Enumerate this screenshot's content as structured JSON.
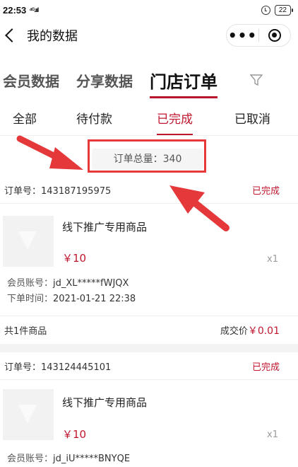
{
  "status_bar": {
    "time": "22:53",
    "signal": "⁴ᴳ.ııl",
    "battery": "22"
  },
  "navbar": {
    "title": "我的数据",
    "more_label": "•••"
  },
  "main_tabs": [
    {
      "label": "会员数据"
    },
    {
      "label": "分享数据"
    },
    {
      "label": "门店订单",
      "active": true
    }
  ],
  "sub_tabs": [
    {
      "label": "全部"
    },
    {
      "label": "待付款"
    },
    {
      "label": "已完成",
      "active": true
    },
    {
      "label": "已取消"
    }
  ],
  "total": {
    "label": "订单总量：",
    "value": "340"
  },
  "orders": [
    {
      "order_label": "订单号：",
      "order_no": "143187195975",
      "status": "已完成",
      "product_name": "线下推广专用商品",
      "price": "￥10",
      "qty": "x1",
      "member_label": "会员账号：",
      "member_id": "jd_XL*****fWJQX",
      "time_label": "下单时间：",
      "time": "2021-01-21 22:38",
      "summary": "共1件商品",
      "deal_label": "成交价",
      "deal_value": "￥0.01"
    },
    {
      "order_label": "订单号：",
      "order_no": "143124445101",
      "status": "已完成",
      "product_name": "线下推广专用商品",
      "price": "￥10",
      "qty": "x1",
      "member_label": "会员账号：",
      "member_id": "jd_iU*****BNYQE"
    }
  ],
  "colors": {
    "accent": "#c0172f",
    "annotation": "#e5383b"
  }
}
